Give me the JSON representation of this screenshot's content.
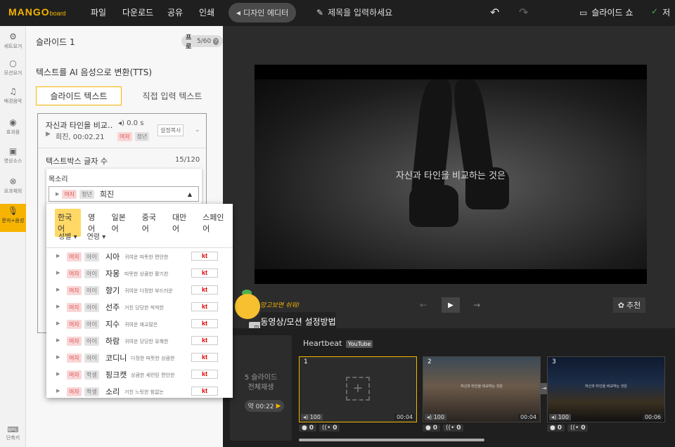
{
  "topbar": {
    "logo_main": "MANGO",
    "logo_sub": "board",
    "menu": [
      "파일",
      "다운로드",
      "공유",
      "인쇄"
    ],
    "design_editor": "디자인 에디터",
    "title_placeholder": "제목을 입력하세요",
    "slideshow": "슬라이드 쇼",
    "save": "저"
  },
  "leftnav": [
    {
      "label": "세트요거",
      "icon": "gear-icon"
    },
    {
      "label": "모션요거",
      "icon": "circle-icon"
    },
    {
      "label": "배경음악",
      "icon": "music-icon"
    },
    {
      "label": "효과음",
      "icon": "sound-icon"
    },
    {
      "label": "영상소스",
      "icon": "film-icon"
    },
    {
      "label": "요과재외",
      "icon": "close-circle-icon"
    },
    {
      "label": "문자+음성",
      "icon": "mic-icon"
    }
  ],
  "leftnav_bottom": {
    "label": "단축키",
    "icon": "keyboard-icon"
  },
  "panel": {
    "slide_title": "슬라이드 1",
    "pro_label": "프로",
    "pro_count": "5/60",
    "tts_label": "텍스트를 AI 음성으로 변환(TTS)",
    "tab_slide_text": "슬라이드 텍스트",
    "tab_direct_text": "직접 입력 텍스트",
    "card": {
      "text": "자신과 타인을 비교…",
      "time": "0.0 s",
      "voice": "희진, 00:02.21",
      "tag_gender": "여자",
      "tag_age": "청년",
      "copy_setting": "설정복사",
      "count_label": "텍스트박스 글자 수",
      "count": "15/120"
    }
  },
  "voice_select": {
    "label": "목소리",
    "tag_gender": "여자",
    "tag_age": "청년",
    "name": "희진"
  },
  "voice_popup": {
    "languages": [
      "한국어",
      "영어",
      "일본어",
      "중국어",
      "대만어",
      "스페인어"
    ],
    "active_language": "한국어",
    "filters": [
      "성별",
      "연령"
    ],
    "voices": [
      {
        "gender": "여자",
        "age": "아이",
        "name": "시아",
        "desc": "귀여운 따뜻한 편안한",
        "provider": "kt"
      },
      {
        "gender": "여자",
        "age": "아이",
        "name": "자몽",
        "desc": "따뜻한 상큼한 활기찬",
        "provider": "kt"
      },
      {
        "gender": "여자",
        "age": "아이",
        "name": "향기",
        "desc": "귀여운 다정한 부드러운",
        "provider": "kt"
      },
      {
        "gender": "여자",
        "age": "아이",
        "name": "선주",
        "desc": "거친 당당한 씩씩한",
        "provider": "kt"
      },
      {
        "gender": "여자",
        "age": "아이",
        "name": "지수",
        "desc": "귀여운 애교많은",
        "provider": "kt"
      },
      {
        "gender": "여자",
        "age": "아이",
        "name": "하람",
        "desc": "귀여운 당당한 유쾌한",
        "provider": "kt"
      },
      {
        "gender": "여자",
        "age": "아이",
        "name": "코디니",
        "desc": "다정한 따뜻한 상큼한",
        "provider": "kt"
      },
      {
        "gender": "여자",
        "age": "학생",
        "name": "핑크캣",
        "desc": "상큼한 세련된 편안한",
        "provider": "kt"
      },
      {
        "gender": "여자",
        "age": "학생",
        "name": "소리",
        "desc": "거친 느릿한 힘없는",
        "provider": "kt"
      }
    ]
  },
  "stage": {
    "caption": "자신과 타인을 비교하는 것은",
    "recommend": "추천"
  },
  "hint": {
    "small": "망고보면 쉬워!",
    "box": "동영상/모션 설정방법"
  },
  "timeline": {
    "slide_count": "5 슬라이드",
    "play_all": "전체재생",
    "duration": "약 00:22",
    "music": "Heartbeat",
    "music_source": "YouTube",
    "thumbs": [
      {
        "num": "1",
        "volume": "100",
        "time": "00:04"
      },
      {
        "num": "2",
        "volume": "100",
        "time": "00:04",
        "caption": "자신과 타인을 비교하는 것은"
      },
      {
        "num": "3",
        "volume": "100",
        "time": "00:06",
        "caption": "자신과 타인을 비교하는 것은"
      }
    ],
    "ctrl_values": [
      "0",
      "0",
      "0",
      "0",
      "0",
      "0"
    ]
  }
}
